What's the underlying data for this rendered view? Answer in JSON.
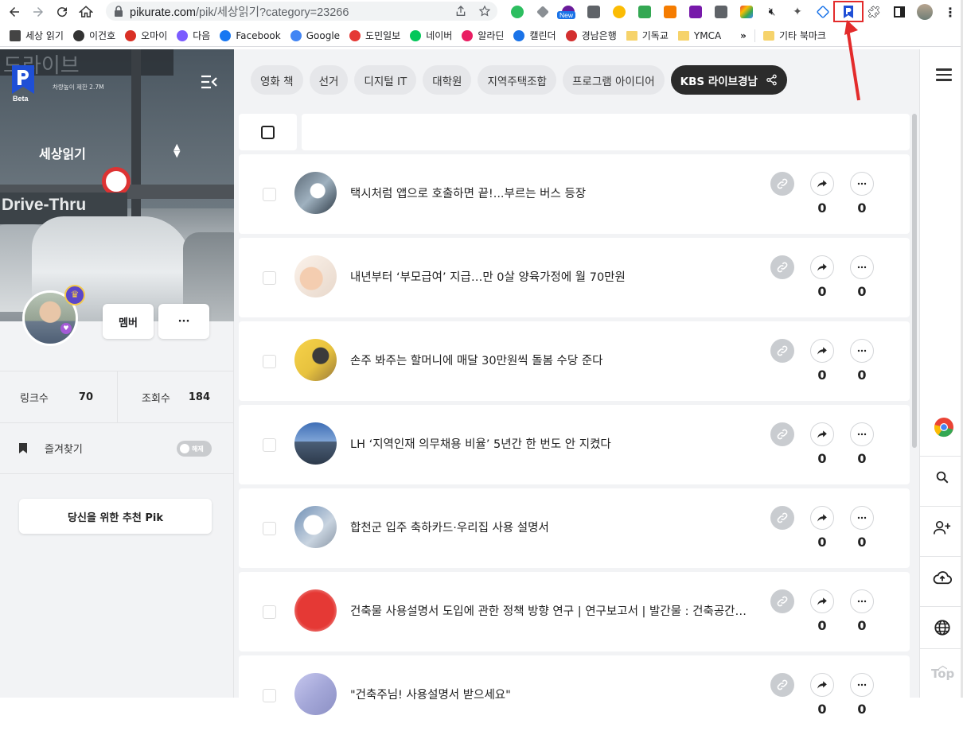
{
  "browser": {
    "url_host": "pikurate.com",
    "url_path": "/pik/세상읽기?category=23266",
    "new_badge": "New",
    "bookmarks": [
      {
        "label": "세상 읽기",
        "icon": "apps-grid-icon",
        "color": "#444444"
      },
      {
        "label": "이건호",
        "icon": "globe-icon",
        "color": "#333333"
      },
      {
        "label": "오마이",
        "icon": "ohmy-icon",
        "color": "#d93025"
      },
      {
        "label": "다음",
        "icon": "daum-icon",
        "color": "#7b5cff"
      },
      {
        "label": "Facebook",
        "icon": "facebook-icon",
        "color": "#1877f2"
      },
      {
        "label": "Google",
        "icon": "google-icon",
        "color": "#4285f4"
      },
      {
        "label": "도민일보",
        "icon": "domin-icon",
        "color": "#e53935"
      },
      {
        "label": "네이버",
        "icon": "naver-icon",
        "color": "#03c75a"
      },
      {
        "label": "알라딘",
        "icon": "aladin-icon",
        "color": "#e91e63"
      },
      {
        "label": "캘린더",
        "icon": "calendar-icon",
        "color": "#1a73e8"
      },
      {
        "label": "경남은행",
        "icon": "bnk-icon",
        "color": "#d32f2f"
      },
      {
        "label": "기독교",
        "icon": "folder-icon",
        "color": "#f6d36b"
      },
      {
        "label": "YMCA",
        "icon": "folder-icon",
        "color": "#f6d36b"
      }
    ],
    "bookmarks_more": "»",
    "other_bookmarks": "기타 북마크"
  },
  "sidebar": {
    "logo_badge": "Beta",
    "category_title": "세상읽기",
    "cover_sign": "드라이브",
    "cover_sign_small": "차량높이 제한 2.7M",
    "cover_drive_thru": "Drive-Thru",
    "member_label": "멤버",
    "more_label": "···",
    "stats": [
      {
        "label": "링크수",
        "value": "70"
      },
      {
        "label": "조회수",
        "value": "184"
      }
    ],
    "favorites_label": "즐겨찾기",
    "toggle_label": "해제",
    "recommend_label": "당신을 위한 추천 Pik"
  },
  "tags": [
    {
      "label": "영화 책",
      "active": false
    },
    {
      "label": "선거",
      "active": false
    },
    {
      "label": "디지털 IT",
      "active": false
    },
    {
      "label": "대학원",
      "active": false
    },
    {
      "label": "지역주택조합",
      "active": false
    },
    {
      "label": "프로그램 아이디어",
      "active": false
    },
    {
      "label": "KBS 라이브경남",
      "active": true
    }
  ],
  "items": [
    {
      "title": "택시처럼 앱으로 호출하면 끝!...부르는 버스 등장",
      "shares": "0",
      "comments": "0",
      "thumb": "bus-app-photo"
    },
    {
      "title": "내년부터 ‘부모급여’ 지급…만 0살 양육가정에 월 70만원",
      "shares": "0",
      "comments": "0",
      "thumb": "baby-hands-photo"
    },
    {
      "title": "손주 봐주는 할머니에 매달 30만원씩 돌봄 수당 준다",
      "shares": "0",
      "comments": "0",
      "thumb": "press-conference-photo"
    },
    {
      "title": "LH ‘지역인재 의무채용 비율’ 5년간 한 번도 안 지켰다",
      "shares": "0",
      "comments": "0",
      "thumb": "lh-building-photo"
    },
    {
      "title": "합천군 입주 축하카드·우리집 사용 설명서",
      "shares": "0",
      "comments": "0",
      "thumb": "welcome-card-photo"
    },
    {
      "title": "건축물 사용설명서 도입에 관한 정책 방향 연구 | 연구보고서 | 발간물 : 건축공간연구원",
      "shares": "0",
      "comments": "0",
      "thumb": "red-logo-photo"
    },
    {
      "title": "\"건축주님! 사용설명서 받으세요\"",
      "shares": "0",
      "comments": "0",
      "thumb": "manual-photo"
    }
  ],
  "rail": {
    "top_label": "Top"
  },
  "colors": {
    "accent_dark": "#2b2b2b",
    "highlight_red": "#e32b2b",
    "pik_blue": "#1f4fd6"
  }
}
